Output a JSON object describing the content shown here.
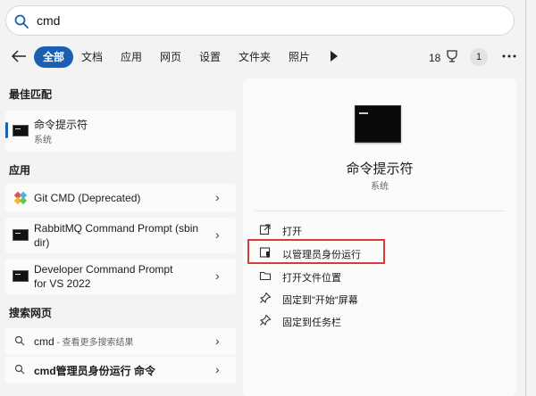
{
  "search": {
    "query": "cmd"
  },
  "filters": {
    "tabs": [
      "全部",
      "文档",
      "应用",
      "网页",
      "设置",
      "文件夹",
      "照片"
    ],
    "count": "18",
    "avatar": "1"
  },
  "sections": {
    "best_match": "最佳匹配",
    "apps": "应用",
    "web": "搜索网页"
  },
  "best_match": {
    "title": "命令提示符",
    "sub": "系统"
  },
  "apps": [
    {
      "title": "Git CMD (Deprecated)"
    },
    {
      "title": "RabbitMQ Command Prompt (sbin dir)"
    },
    {
      "title": "Developer Command Prompt for VS 2022"
    }
  ],
  "web": [
    {
      "query": "cmd",
      "suffix": " - 查看更多搜索结果"
    },
    {
      "query": "cmd管理员身份运行 命令",
      "suffix": ""
    }
  ],
  "detail": {
    "title": "命令提示符",
    "sub": "系统",
    "actions": [
      "打开",
      "以管理员身份运行",
      "打开文件位置",
      "固定到\"开始\"屏幕",
      "固定到任务栏"
    ]
  },
  "colors": {
    "accent": "#1a5fb4",
    "highlight": "#d93b3b"
  },
  "icons": [
    "search-icon",
    "back-arrow-icon",
    "play-icon",
    "trophy-icon",
    "more-icon",
    "cmd-icon",
    "git-icon",
    "chevron-right-icon",
    "open-icon",
    "shield-icon",
    "folder-icon",
    "pin-icon"
  ]
}
